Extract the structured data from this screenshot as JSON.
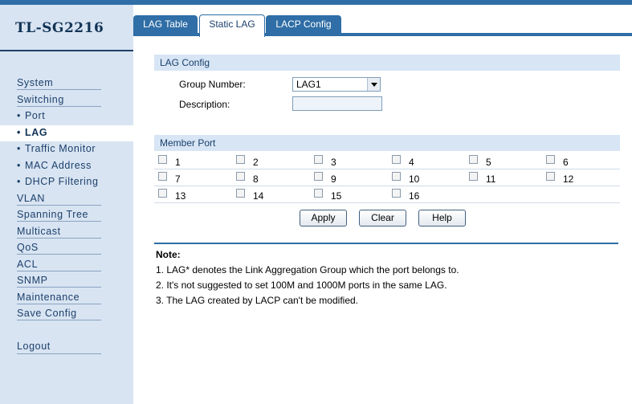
{
  "app": {
    "product_name": "TL-SG2216"
  },
  "sidebar": {
    "items": [
      {
        "label": "System",
        "sub": false,
        "active": false
      },
      {
        "label": "Switching",
        "sub": false,
        "active": false
      },
      {
        "label": "Port",
        "sub": true,
        "active": false
      },
      {
        "label": "LAG",
        "sub": true,
        "active": true
      },
      {
        "label": "Traffic Monitor",
        "sub": true,
        "active": false
      },
      {
        "label": "MAC Address",
        "sub": true,
        "active": false
      },
      {
        "label": "DHCP Filtering",
        "sub": true,
        "active": false
      },
      {
        "label": "VLAN",
        "sub": false,
        "active": false
      },
      {
        "label": "Spanning Tree",
        "sub": false,
        "active": false
      },
      {
        "label": "Multicast",
        "sub": false,
        "active": false
      },
      {
        "label": "QoS",
        "sub": false,
        "active": false
      },
      {
        "label": "ACL",
        "sub": false,
        "active": false
      },
      {
        "label": "SNMP",
        "sub": false,
        "active": false
      },
      {
        "label": "Maintenance",
        "sub": false,
        "active": false
      },
      {
        "label": "Save Config",
        "sub": false,
        "active": false
      }
    ],
    "logout_label": "Logout"
  },
  "tabs": [
    {
      "label": "LAG Table",
      "active": false
    },
    {
      "label": "Static LAG",
      "active": true
    },
    {
      "label": "LACP Config",
      "active": false
    }
  ],
  "lag_config": {
    "header": "LAG Config",
    "group_number_label": "Group Number:",
    "group_number_value": "LAG1",
    "description_label": "Description:",
    "description_value": ""
  },
  "member_port": {
    "header": "Member Port",
    "ports": [
      "1",
      "2",
      "3",
      "4",
      "5",
      "6",
      "7",
      "8",
      "9",
      "10",
      "11",
      "12",
      "13",
      "14",
      "15",
      "16"
    ],
    "checked": []
  },
  "buttons": {
    "apply": "Apply",
    "clear": "Clear",
    "help": "Help"
  },
  "notes": {
    "title": "Note:",
    "items": [
      "1. LAG* denotes the Link Aggregation Group which the port belongs to.",
      "2. It's not suggested to set 100M and 1000M ports in the same LAG.",
      "3. The LAG created by LACP can't be modified."
    ]
  },
  "colors": {
    "brand_blue": "#2f6ea6",
    "sidebar_bg": "#d8e4f2",
    "header_bg": "#d7e5f5"
  }
}
